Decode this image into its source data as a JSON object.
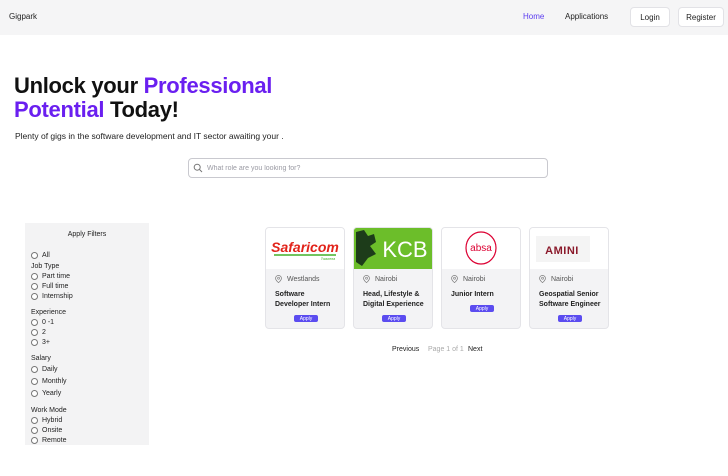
{
  "nav": {
    "brand": "Gigpark",
    "links": [
      "Home",
      "Applications"
    ],
    "login": "Login",
    "register": "Register"
  },
  "hero": {
    "title_part1": "Unlock your ",
    "title_accent": "Professional Potential",
    "title_part2": " Today!",
    "subtitle": "Plenty of gigs in the software development and IT sector awaiting your ."
  },
  "search": {
    "placeholder": "What role are you looking for?"
  },
  "filters": {
    "title": "Apply Filters",
    "all": "All",
    "job_type": {
      "label": "Job Type",
      "options": [
        "Part time",
        "Full time",
        "Internship"
      ]
    },
    "experience": {
      "label": "Experience",
      "options": [
        "0 -1",
        "2",
        "3+"
      ]
    },
    "salary": {
      "label": "Salary",
      "options": [
        "Daily",
        "Monthly",
        "Yearly"
      ]
    },
    "work_mode": {
      "label": "Work Mode",
      "options": [
        "Hybrid",
        "Onsite",
        "Remote"
      ]
    }
  },
  "jobs": [
    {
      "company": "Safaricom",
      "logo_tagline": "Twaweza",
      "location": "Westlands",
      "title": "Software Developer Intern",
      "apply": "Apply"
    },
    {
      "company": "KCB",
      "location": "Nairobi",
      "title": "Head, Lifestyle & Digital Experience",
      "apply": "Apply"
    },
    {
      "company": "absa",
      "location": "Nairobi",
      "title": "Junior Intern",
      "apply": "Apply"
    },
    {
      "company": "AMINI",
      "location": "Nairobi",
      "title": "Geospatial Senior Software Engineer",
      "apply": "Apply"
    }
  ],
  "pagination": {
    "previous": "Previous",
    "info": "Page 1 of 1",
    "next": "Next"
  },
  "colors": {
    "accent": "#6a1ff0",
    "apply_button": "#5b4cf0",
    "safaricom_red": "#e2231a",
    "safaricom_green": "#43b02a",
    "kcb_green": "#6cbe2a",
    "absa_red": "#dc0032"
  }
}
